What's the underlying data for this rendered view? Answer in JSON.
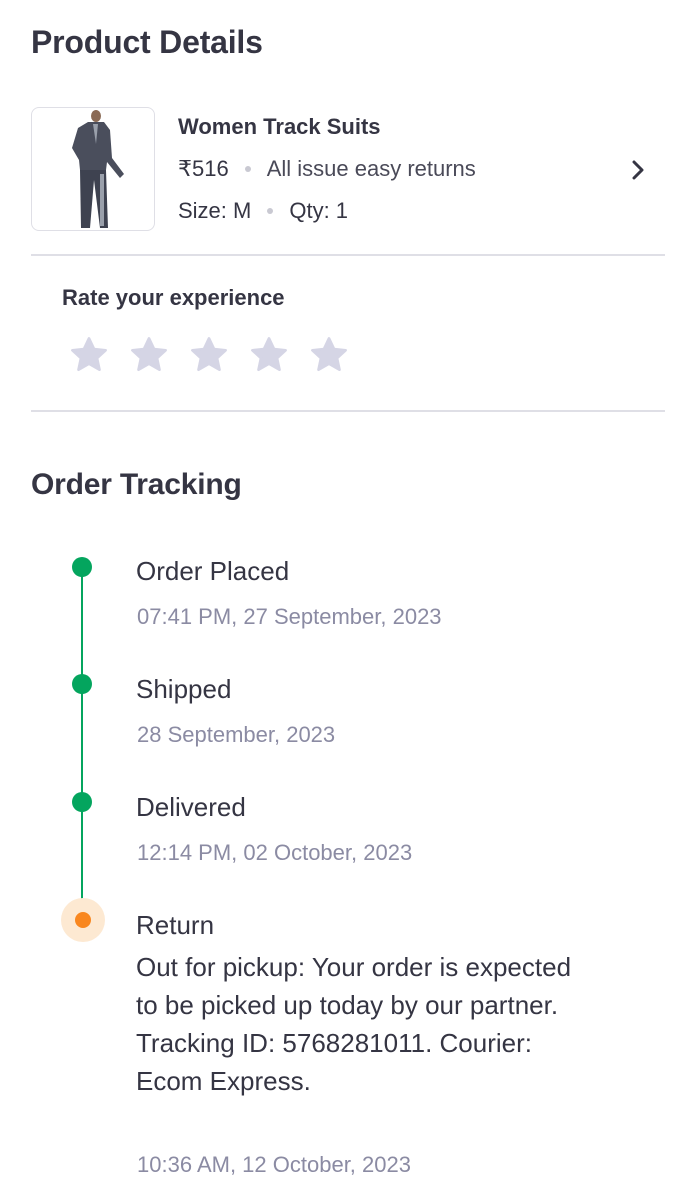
{
  "product_section": {
    "title": "Product Details",
    "product": {
      "image_icon": "women-tracksuit-image",
      "name": "Women Track Suits",
      "price": "₹516",
      "returns": "All issue easy returns",
      "size": "Size: M",
      "qty": "Qty: 1"
    }
  },
  "rating": {
    "label": "Rate your experience",
    "stars": 5,
    "selected": 0,
    "star_icon": "star-icon"
  },
  "tracking": {
    "title": "Order Tracking",
    "steps": [
      {
        "title": "Order Placed",
        "date": "07:41 PM, 27 September, 2023",
        "status": "done"
      },
      {
        "title": "Shipped",
        "date": "28 September, 2023",
        "status": "done"
      },
      {
        "title": "Delivered",
        "date": "12:14 PM, 02 October, 2023",
        "status": "done"
      },
      {
        "title": "Return",
        "description": "Out for pickup: Your order is expected to be picked up today by our partner. Tracking ID: 5768281011. Courier: Ecom Express.",
        "date": "10:36 AM, 12 October, 2023",
        "status": "current"
      }
    ]
  },
  "colors": {
    "done": "#04a55e",
    "current": "#f9871f",
    "star_inactive": "#d5d5e5",
    "text": "#353543",
    "muted_text": "#8b8ba3"
  }
}
